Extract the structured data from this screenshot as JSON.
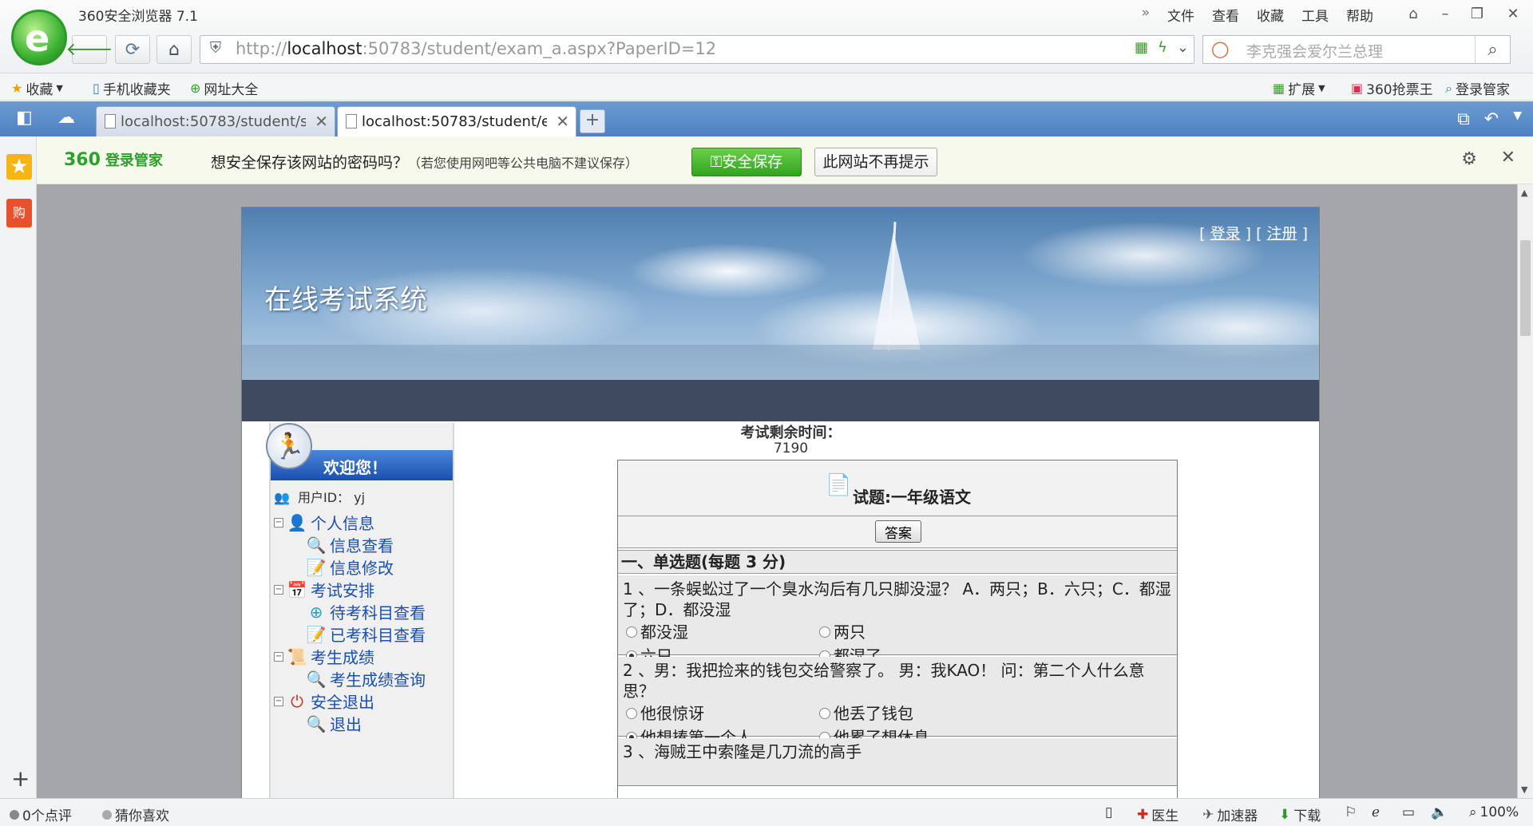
{
  "browser": {
    "title": "360安全浏览器 7.1",
    "menu": [
      "文件",
      "查看",
      "收藏",
      "工具",
      "帮助"
    ],
    "menu_more": "»",
    "url_prefix": "http://",
    "url_host": "localhost",
    "url_rest": ":50783/student/exam_a.aspx?PaperID=12",
    "search_placeholder": "李克强会爱尔兰总理",
    "bookmarks": [
      "收藏",
      "手机收藏夹",
      "网址大全"
    ],
    "bookmarks_right": [
      "扩展",
      "360抢票王",
      "登录管家"
    ],
    "tabs": [
      {
        "label": "localhost:50783/student/stu",
        "active": false
      },
      {
        "label": "localhost:50783/student/ex",
        "active": true
      }
    ]
  },
  "password_bar": {
    "brand": "360",
    "brand_sub": "登录管家",
    "message": "想安全保存该网站的密码吗？",
    "note": "（若您使用网吧等公共电脑不建议保存）",
    "save_label": "安全保存",
    "never_label": "此网站不再提示"
  },
  "page": {
    "site_title": "在线考试系统",
    "login_link": "登录",
    "register_link": "注册",
    "nav": {
      "welcome": "欢迎您！",
      "user_label": "用户ID：",
      "user_id": "yj",
      "groups": [
        {
          "label": "个人信息",
          "items": [
            "信息查看",
            "信息修改"
          ]
        },
        {
          "label": "考试安排",
          "items": [
            "待考科目查看",
            "已考科目查看"
          ]
        },
        {
          "label": "考生成绩",
          "items": [
            "考生成绩查询"
          ]
        },
        {
          "label": "安全退出",
          "items": [
            "退出"
          ]
        }
      ]
    },
    "exam": {
      "timer_label": "考试剩余时间：",
      "timer_value": "7190",
      "title": "试题:一年级语文",
      "answer_button": "答案",
      "section": "一、单选题(每题 3 分)",
      "questions": [
        {
          "stem": "1 、一条蜈蚣过了一个臭水沟后有几只脚没湿？ A．两只；B．六只；C．都湿了；D．都没湿",
          "options": [
            "都没湿",
            "两只",
            "六只",
            "都湿了"
          ],
          "selected": 2
        },
        {
          "stem": "2 、男：我把捡来的钱包交给警察了。 男：我KAO！ 问：第二个人什么意思？",
          "options": [
            "他很惊讶",
            "他丢了钱包",
            "他想揍第一个人",
            "他累了想休息"
          ],
          "selected": 2
        },
        {
          "stem": "3 、海贼王中索隆是几刀流的高手",
          "options": [],
          "selected": -1
        }
      ]
    }
  },
  "status": {
    "comments": "0个点评",
    "guess": "猜你喜欢",
    "doctor": "医生",
    "accelerator": "加速器",
    "download": "下载",
    "zoom": "100%"
  }
}
